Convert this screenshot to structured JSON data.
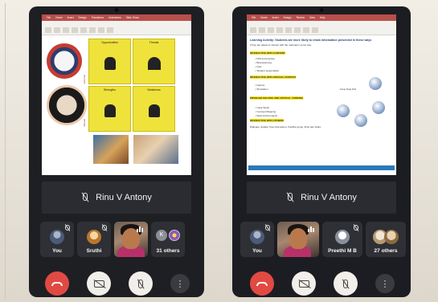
{
  "left_phone": {
    "speaker_name": "Rinu V Antony",
    "slide_ribbon_tabs": [
      "File",
      "Home",
      "Insert",
      "Design",
      "Transitions",
      "Animations",
      "Slide Show",
      "Review",
      "View",
      "Recording",
      "Help"
    ],
    "swot": {
      "top_left": "Opportunities",
      "top_right": "Threats",
      "bottom_left": "Strengths",
      "bottom_right": "Weakness",
      "side_top": "External",
      "side_bottom": "Internal"
    },
    "participants": [
      {
        "name": "You",
        "type": "avatar"
      },
      {
        "name": "Sruthi",
        "type": "avatar"
      },
      {
        "name": "",
        "type": "video"
      },
      {
        "name": "31 others",
        "type": "group",
        "badge": "K"
      }
    ],
    "colors": {
      "end_call": "#e14a43",
      "swot_fill": "#efe23b"
    }
  },
  "right_phone": {
    "speaker_name": "Rinu V Antony",
    "slide": {
      "title": "Learning Activity: Students are more likely to retain information presented in these ways",
      "subtitle": "if they are asked to interact with the material in some way",
      "section1": "INTERACTIVE WITH CONTENT",
      "section1_items": [
        "Drill and practice",
        "Brainstorming",
        "Quiz",
        "Student presentation"
      ],
      "section2": "INTERACTIVE WITH SPECIAL CONTEXT",
      "section2_items": [
        "Games",
        "Simulation"
      ],
      "section3": "PROBLEM SOLVING AND CRITICAL THINKING",
      "section3_items": [
        "Case Study",
        "Concept Mapping",
        "Real world projects"
      ],
      "section4": "INTERACTIVE WITH OTHERS",
      "footer": "Dialogue, debate, Peer discussion, Flexible group, think pair share",
      "cycle_label": "Group Study Pool"
    },
    "participants": [
      {
        "name": "You",
        "type": "avatar"
      },
      {
        "name": "",
        "type": "video"
      },
      {
        "name": "Preethi M B",
        "type": "avatar"
      },
      {
        "name": "27 others",
        "type": "group"
      }
    ]
  },
  "icons": [
    "mic-off-icon",
    "camera-off-icon",
    "hangup-icon",
    "more-icon",
    "audio-bars-icon"
  ]
}
